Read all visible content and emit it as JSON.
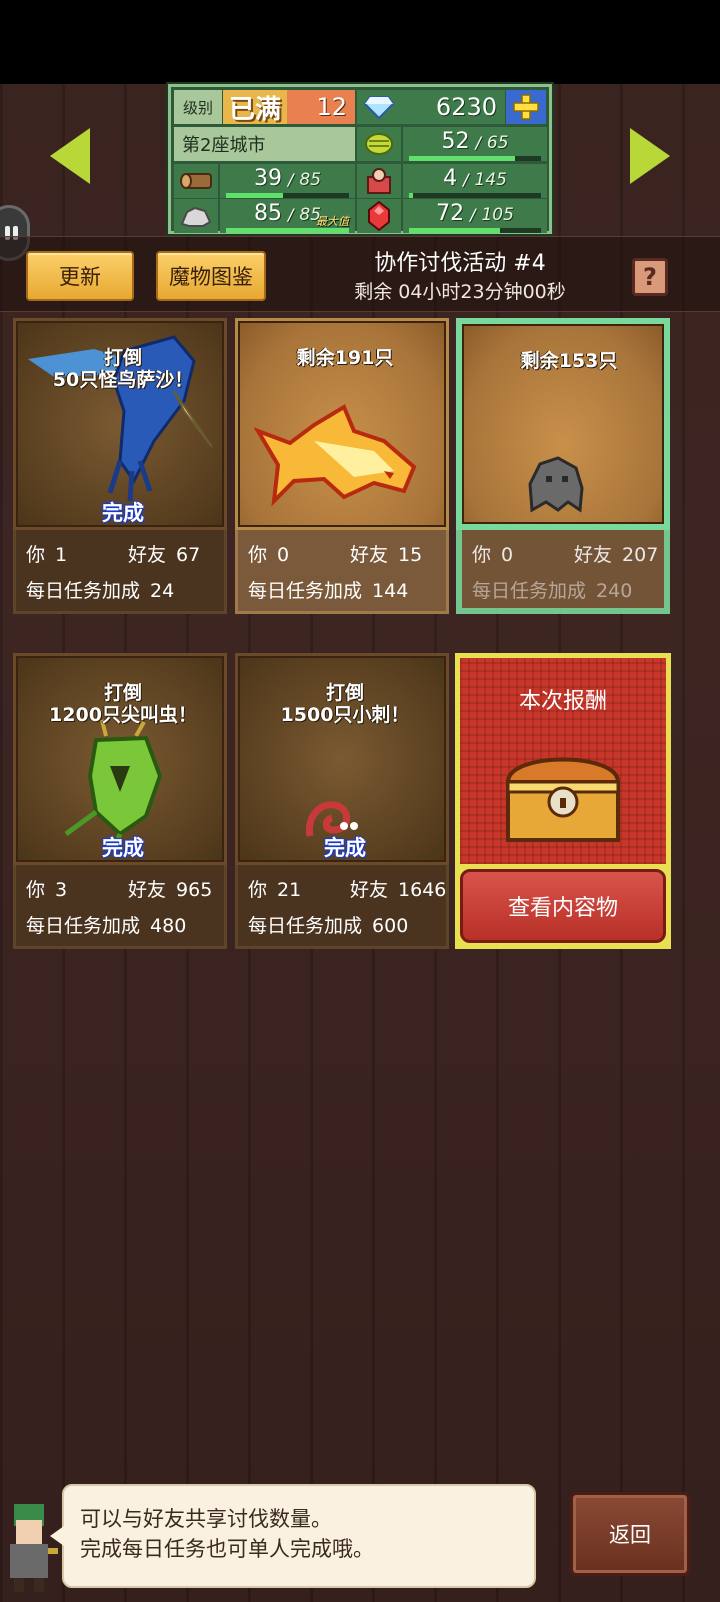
{
  "header": {
    "level_label": "级别",
    "level_max": "已满",
    "level": "12",
    "gems": "6230",
    "city": "第2座城市",
    "resources": [
      {
        "name": "food",
        "current": "52",
        "max": "65",
        "fill": 0.8
      },
      {
        "name": "wood",
        "current": "39",
        "max": "85",
        "fill": 0.46
      },
      {
        "name": "population",
        "current": "4",
        "max": "145",
        "fill": 0.03
      },
      {
        "name": "ore",
        "current": "85",
        "max": "85",
        "fill": 1.0
      },
      {
        "name": "crystal",
        "current": "72",
        "max": "105",
        "fill": 0.69
      }
    ],
    "max_tag": "最大值"
  },
  "event": {
    "refresh_label": "更新",
    "monster_dex_label": "魔物图鉴",
    "title": "协作讨伐活动 #4",
    "timer": "剩余 04小时23分钟00秒",
    "help_label": "?"
  },
  "cards": [
    {
      "caption_line1": "打倒",
      "caption_line2": "50只怪鸟萨沙！",
      "done": "完成",
      "you_label": "你",
      "you": "1",
      "friends_label": "好友",
      "friends": "67",
      "bonus_label": "每日任务加成",
      "bonus": "24"
    },
    {
      "caption_line1": "剩余191只",
      "caption_line2": "",
      "done": "",
      "you_label": "你",
      "you": "0",
      "friends_label": "好友",
      "friends": "15",
      "bonus_label": "每日任务加成",
      "bonus": "144"
    },
    {
      "caption_line1": "剩余153只",
      "caption_line2": "",
      "done": "",
      "you_label": "你",
      "you": "0",
      "friends_label": "好友",
      "friends": "207",
      "bonus_label": "每日任务加成",
      "bonus": "240"
    },
    {
      "caption_line1": "打倒",
      "caption_line2": "1200只尖叫虫！",
      "done": "完成",
      "you_label": "你",
      "you": "3",
      "friends_label": "好友",
      "friends": "965",
      "bonus_label": "每日任务加成",
      "bonus": "480"
    },
    {
      "caption_line1": "打倒",
      "caption_line2": "1500只小刺！",
      "done": "完成",
      "you_label": "你",
      "you": "21",
      "friends_label": "好友",
      "friends": "1646",
      "bonus_label": "每日任务加成",
      "bonus": "600"
    }
  ],
  "reward": {
    "title": "本次报酬",
    "view_label": "查看内容物"
  },
  "tip": {
    "line1": "可以与好友共享讨伐数量。",
    "line2": "完成每日任务也可单人完成哦。"
  },
  "back_label": "返回",
  "colors": {
    "accent_green": "#7ad89a",
    "button_yellow": "#fbd06a",
    "reward_red": "#c8362a"
  }
}
